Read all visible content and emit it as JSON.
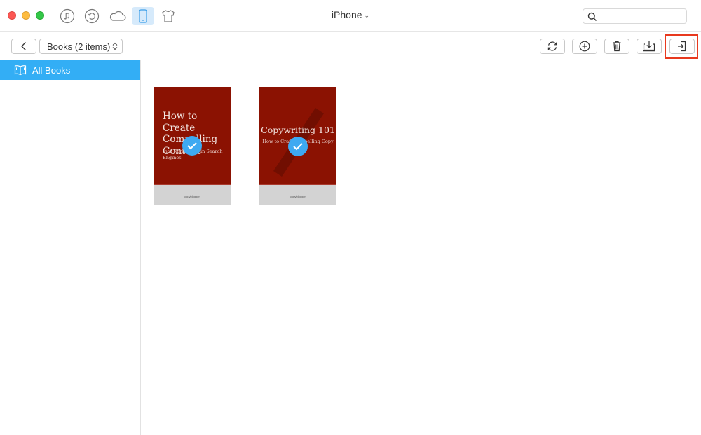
{
  "titlebar": {
    "device_name": "iPhone",
    "device_chevron": "⌄",
    "search": {
      "placeholder": "",
      "value": ""
    },
    "nav_icons": [
      {
        "name": "music-icon",
        "active": false
      },
      {
        "name": "restore-icon",
        "active": false
      },
      {
        "name": "cloud-icon",
        "active": false
      },
      {
        "name": "device-icon",
        "active": true
      },
      {
        "name": "shirt-icon",
        "active": false
      }
    ]
  },
  "toolbar": {
    "category_label": "Books (2 items)",
    "buttons": [
      "refresh",
      "add",
      "delete",
      "export-to-computer",
      "import-to-device"
    ],
    "highlighted_button": "import-to-device",
    "highlight_color": "#e8391e"
  },
  "sidebar": {
    "items": [
      {
        "label": "All Books",
        "active": true
      }
    ],
    "active_color": "#33aef5"
  },
  "books": [
    {
      "title": "How to Create Compelling Content",
      "subtitle": "that Ranks Well in Search Engines",
      "publisher": "copyblogger",
      "selected": true
    },
    {
      "title": "Copywriting 101",
      "subtitle": "How to Craft Compelling Copy",
      "publisher": "copyblogger",
      "selected": true
    }
  ],
  "colors": {
    "cover": "#8b1202",
    "check": "#3ea9f1"
  }
}
